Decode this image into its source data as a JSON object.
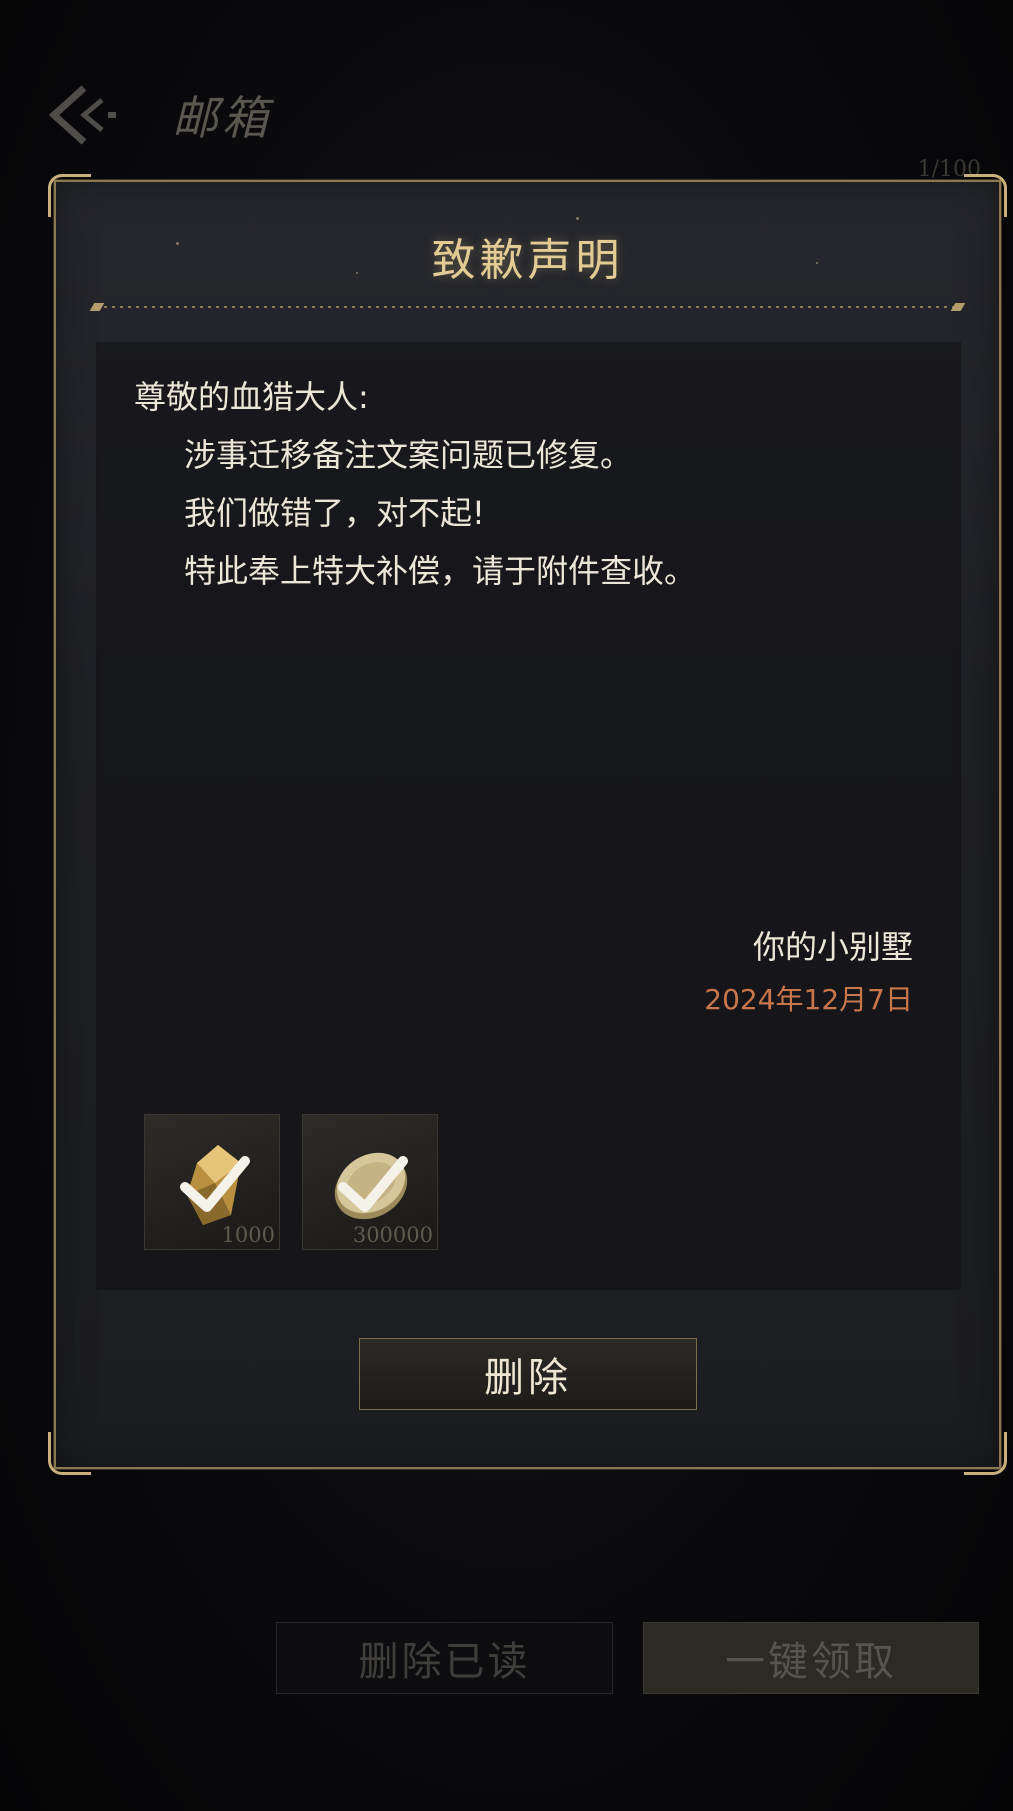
{
  "header": {
    "title": "邮箱",
    "counter": "1/100"
  },
  "modal": {
    "title": "致歉声明",
    "greeting": "尊敬的血猎大人:",
    "body_lines": [
      "涉事迁移备注文案问题已修复。",
      "我们做错了，对不起!",
      "特此奉上特大补偿，请于附件查收。"
    ],
    "signature": "你的小别墅",
    "date": "2024年12月7日",
    "attachments": [
      {
        "icon": "gold-crystal-icon",
        "quantity": "1000",
        "claimed": true
      },
      {
        "icon": "gold-coin-icon",
        "quantity": "300000",
        "claimed": true
      }
    ],
    "delete_label": "删除"
  },
  "footer": {
    "delete_read_label": "删除已读",
    "claim_all_label": "一键领取"
  },
  "colors": {
    "accent_gold": "#e3cc93",
    "date_orange": "#c8764a",
    "frame_gold": "#8b7850"
  }
}
